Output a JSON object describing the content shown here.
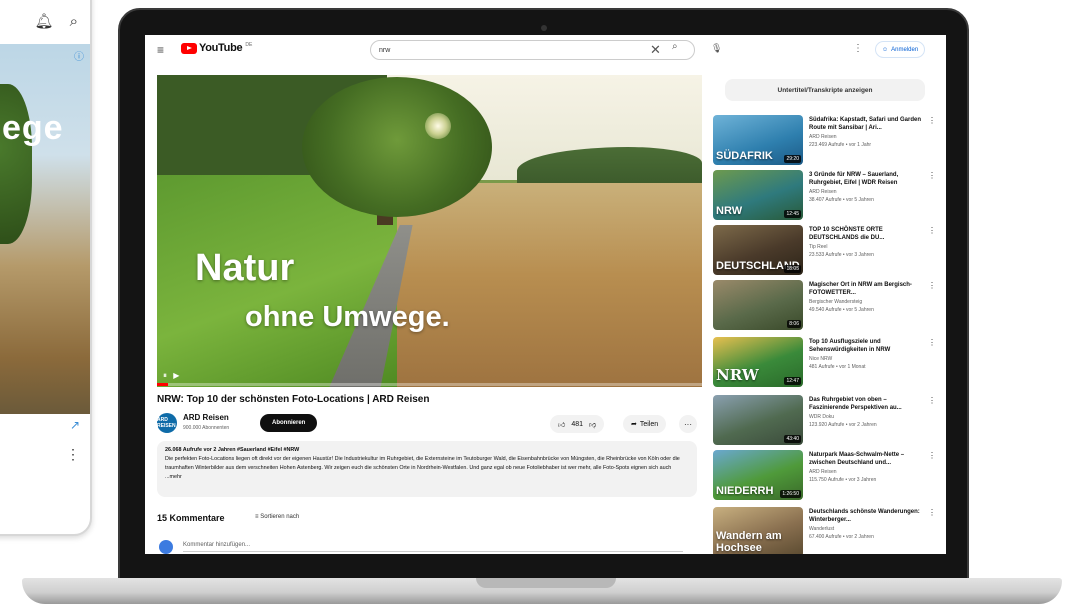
{
  "header": {
    "logo_text": "YouTube",
    "logo_suffix": "DE",
    "search_value": "nrw",
    "signin_label": "Anmelden"
  },
  "video": {
    "overlay_line1": "Natur",
    "overlay_line2": "ohne Umwege.",
    "progress_fraction": 0.02,
    "title": "NRW: Top 10 der schönsten Foto-Locations | ARD Reisen"
  },
  "channel": {
    "avatar_text": "ARD REISEN",
    "name": "ARD Reisen",
    "subscribers": "900.000 Abonnenten",
    "subscribe_label": "Abonnieren"
  },
  "actions": {
    "likes": "481",
    "share_label": "Teilen",
    "more": "···"
  },
  "description": {
    "meta": "26.068 Aufrufe vor 2 Jahren #Sauerland #Eifel #NRW",
    "text": "Die perfekten Foto-Locations liegen oft direkt vor der eigenen Haustür! Die Industriekultur im Ruhrgebiet, die Externsteine im Teutoburger Wald, die Eisenbahnbrücke von Müngsten, die Rheinbrücke von Köln oder die traumhaften Winterbilder aus dem verschneiten Hohen Astenberg. Wir zeigen euch die schönsten Orte in Nordrhein-Westfalen. Und ganz egal ob neue Fotoliebhaber ist wer mehr, alle Foto-Spots eignen sich auch ...mehr"
  },
  "comments": {
    "count_label": "15 Kommentare",
    "sort_label": "Sortieren nach",
    "placeholder": "Kommentar hinzufügen..."
  },
  "sidebar": {
    "heading": "Untertitel/Transkripte anzeigen",
    "items": [
      {
        "thumb_label": "SÜDAFRIK",
        "duration": "29:20",
        "title": "Südafrika: Kapstadt, Safari und Garden Route mit Sansibar | Ari...",
        "channel": "ARD Reisen",
        "stats": "223.469 Aufrufe • vor 1 Jahr"
      },
      {
        "thumb_label": "NRW",
        "duration": "12:45",
        "title": "3 Gründe für NRW – Sauerland, Ruhrgebiet, Eifel | WDR Reisen",
        "channel": "ARD Reisen",
        "stats": "38.407 Aufrufe • vor 5 Jahren"
      },
      {
        "thumb_label": "DEUTSCHLAND",
        "duration": "18:05",
        "title": "TOP 10 SCHÖNSTE ORTE DEUTSCHLANDS die DU...",
        "channel": "Tip Reel",
        "stats": "23.533 Aufrufe • vor 3 Jahren"
      },
      {
        "thumb_label": "",
        "duration": "8:06",
        "title": "Magischer Ort in NRW am Bergisch-FOTOWETTER...",
        "channel": "Bergischer Wandersteig",
        "stats": "49.540 Aufrufe • vor 5 Jahren"
      },
      {
        "thumb_label": "NRW",
        "duration": "12:47",
        "title": "Top 10 Ausflugsziele und Sehenswürdigkeiten in NRW",
        "channel": "Nice NRW",
        "stats": "481 Aufrufe • vor 1 Monat"
      },
      {
        "thumb_label": "",
        "duration": "43:40",
        "title": "Das Ruhrgebiet von oben – Faszinierende Perspektiven au...",
        "channel": "WDR Doku",
        "stats": "123.920 Aufrufe • vor 2 Jahren"
      },
      {
        "thumb_label": "NIEDERRH",
        "duration": "1:26:50",
        "title": "Naturpark Maas-Schwalm-Nette – zwischen Deutschland und...",
        "channel": "ARD Reisen",
        "stats": "115.750 Aufrufe • vor 3 Jahren"
      },
      {
        "thumb_label": "Wandern am Hochsee",
        "duration": "",
        "title": "Deutschlands schönste Wanderungen: Winterberger...",
        "channel": "Wanderlust",
        "stats": "67.400 Aufrufe • vor 2 Jahren"
      }
    ]
  },
  "phone": {
    "overlay_word": "ege",
    "bell_icon": "bell-icon",
    "search_icon": "search-icon"
  },
  "colors": {
    "yt_red": "#ff0000",
    "subscribe_bg": "#0f0f0f",
    "link_blue": "#065fd4"
  }
}
